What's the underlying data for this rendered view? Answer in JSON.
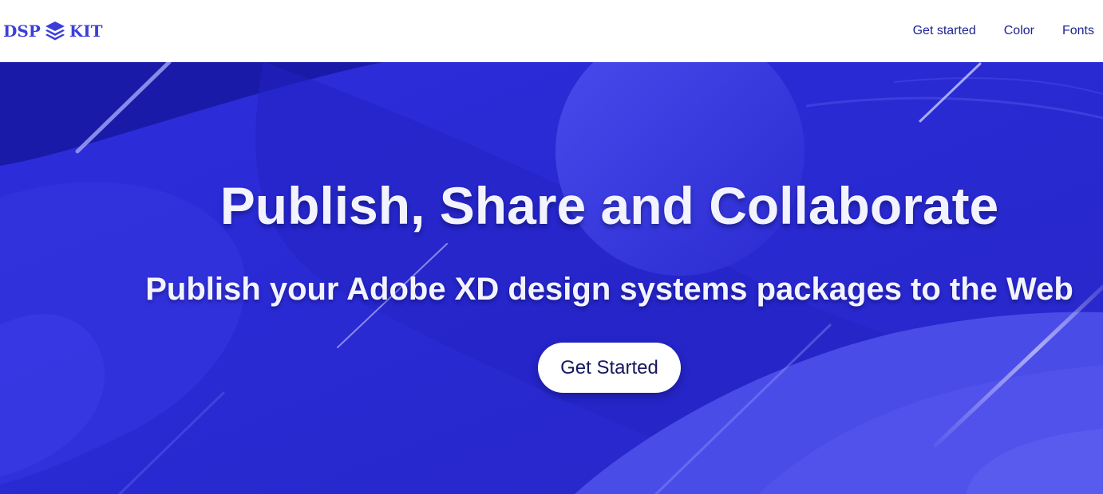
{
  "brand": {
    "left_text": "DSP",
    "right_text": "KIT",
    "logo_icon": "stacked-layers-icon",
    "color": "#3b3fd8"
  },
  "nav": {
    "items": [
      {
        "label": "Get started"
      },
      {
        "label": "Color"
      },
      {
        "label": "Fonts"
      }
    ],
    "text_color": "#1f2390"
  },
  "hero": {
    "title": "Publish, Share and Collaborate",
    "subtitle": "Publish your Adobe XD design systems packages to the Web",
    "cta_label": "Get Started",
    "background_color": "#2a2ad2",
    "text_color": "#f3f3ff"
  }
}
